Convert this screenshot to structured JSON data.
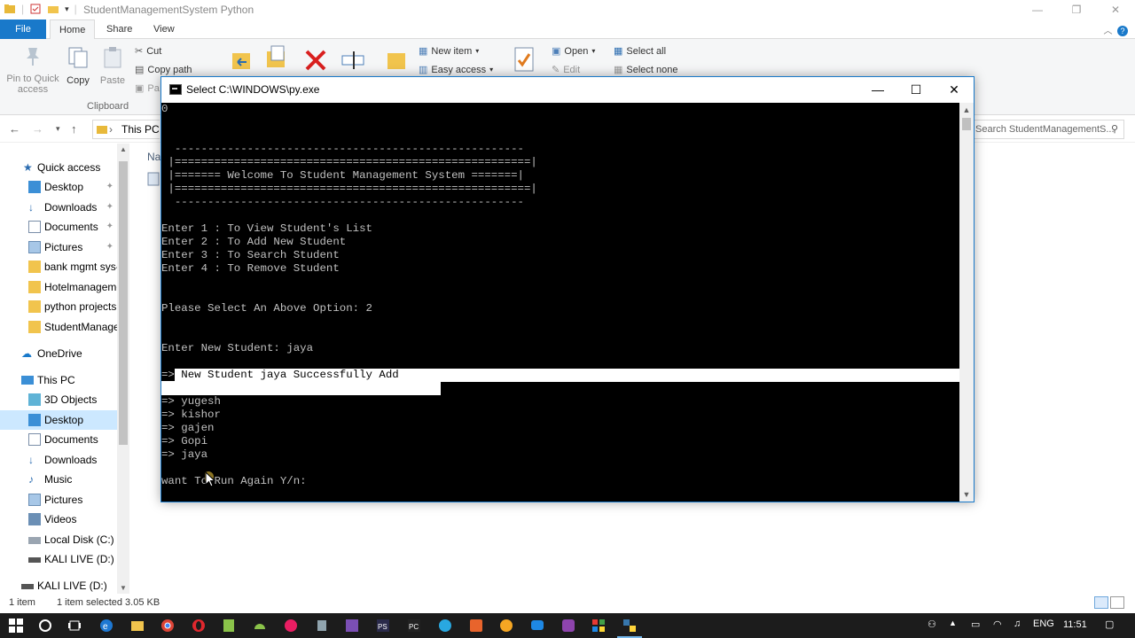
{
  "explorer": {
    "title": "StudentManagementSystem Python",
    "tabs": {
      "file": "File",
      "home": "Home",
      "share": "Share",
      "view": "View"
    },
    "ribbon": {
      "pin_label": "Pin to Quick access",
      "copy_label": "Copy",
      "paste_label": "Paste",
      "cut_label": "Cut",
      "copy_path_label": "Copy path",
      "paste_shortcut_label": "Pa",
      "clipboard_group": "Clipboard",
      "new_item_label": "New item",
      "easy_access_label": "Easy access",
      "open_label": "Open",
      "edit_label": "Edit",
      "select_all_label": "Select all",
      "select_none_label": "Select none"
    },
    "address": {
      "path": "This PC",
      "search_placeholder": "Search StudentManagementS..."
    },
    "column_header": "Na",
    "nav": {
      "quick_access": "Quick access",
      "desktop": "Desktop",
      "downloads": "Downloads",
      "documents": "Documents",
      "pictures": "Pictures",
      "bank": "bank mgmt sys-",
      "hotel": "Hotelmanageme",
      "python_projects": "python projects",
      "student": "StudentManager",
      "onedrive": "OneDrive",
      "this_pc": "This PC",
      "objects3d": "3D Objects",
      "desktop2": "Desktop",
      "documents2": "Documents",
      "downloads2": "Downloads",
      "music": "Music",
      "pictures2": "Pictures",
      "videos": "Videos",
      "local_disk": "Local Disk (C:)",
      "kali1": "KALI LIVE (D:)",
      "kali2": "KALI LIVE (D:)"
    },
    "status": {
      "items": "1 item",
      "selected": "1 item selected  3.05 KB"
    }
  },
  "taskbar": {
    "lang": "ENG",
    "time": "11:51"
  },
  "console": {
    "title": "Select C:\\WINDOWS\\py.exe",
    "lines": {
      "l0": "0",
      "l1": "  -----------------------------------------------------",
      "l2": " |======================================================|",
      "l3": " |======= Welcome To Student Management System =======|",
      "l4": " |======================================================|",
      "l5": "  -----------------------------------------------------",
      "l6": "Enter 1 : To View Student's List",
      "l7": "Enter 2 : To Add New Student",
      "l8": "Enter 3 : To Search Student",
      "l9": "Enter 4 : To Remove Student",
      "l10": "Please Select An Above Option: 2",
      "l11": "Enter New Student: jaya",
      "l12_arrow": "=>",
      "l12_text": " New Student jaya Successfully Add",
      "s1": "=> yugesh",
      "s2": "=> kishor",
      "s3": "=> gajen",
      "s4": "=> Gopi",
      "s5": "=> jaya",
      "prompt": "want To Run Again Y/n:"
    }
  }
}
